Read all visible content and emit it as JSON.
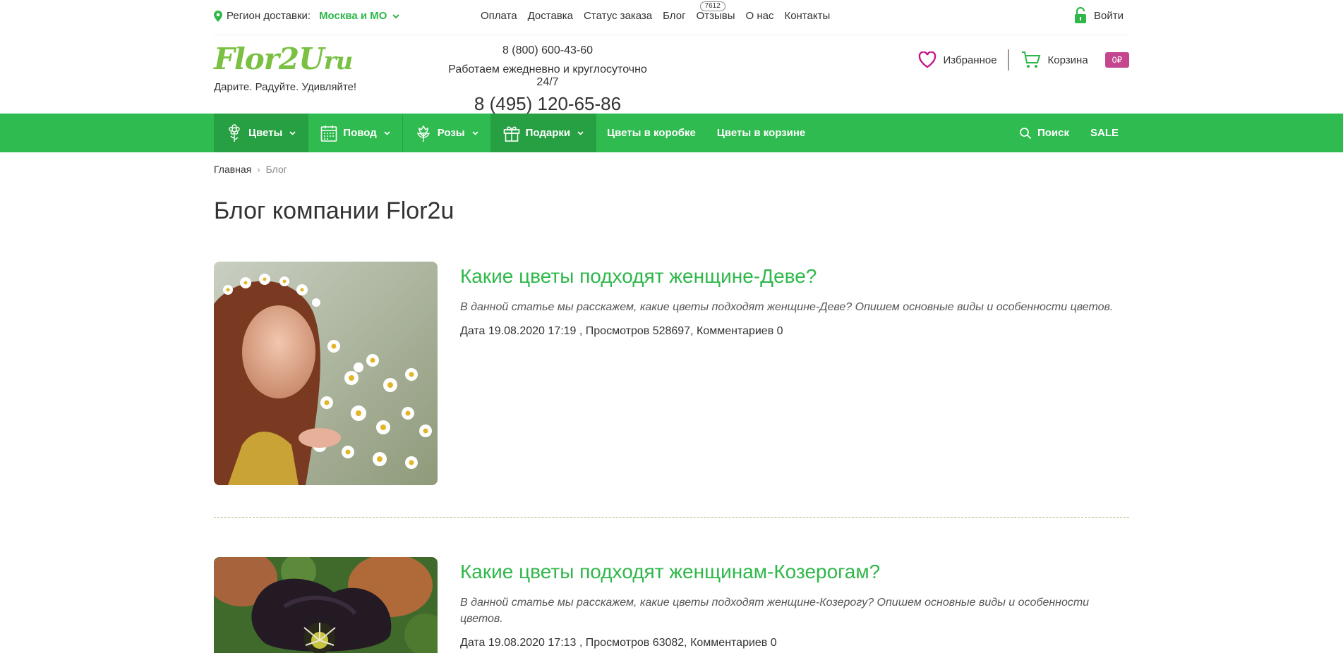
{
  "topbar": {
    "region_label": "Регион доставки:",
    "region_value": "Москва и МО",
    "nav": [
      {
        "label": "Оплата"
      },
      {
        "label": "Доставка"
      },
      {
        "label": "Статус заказа"
      },
      {
        "label": "Блог"
      },
      {
        "label": "Отзывы",
        "badge": "7612"
      },
      {
        "label": "О нас"
      },
      {
        "label": "Контакты"
      }
    ],
    "login_label": "Войти"
  },
  "header": {
    "logo_main": "Flor2U",
    "logo_ru": "ru",
    "slogan": "Дарите. Радуйте. Удивляйте!",
    "phone_free": "8 (800) 600-43-60",
    "hours": "Работаем ежедневно и круглосуточно 24/7",
    "phone_main": "8 (495) 120-65-86",
    "favorites_label": "Избранное",
    "cart_label": "Корзина",
    "cart_total": "0₽"
  },
  "mainnav": {
    "items": [
      {
        "label": "Цветы",
        "icon": "flower-icon"
      },
      {
        "label": "Повод",
        "icon": "calendar-icon"
      },
      {
        "label": "Розы",
        "icon": "rose-icon"
      },
      {
        "label": "Подарки",
        "icon": "gift-icon"
      },
      {
        "label": "Цветы в коробке"
      },
      {
        "label": "Цветы в корзине"
      }
    ],
    "search_label": "Поиск",
    "sale_label": "SALE"
  },
  "breadcrumb": {
    "home": "Главная",
    "current": "Блог"
  },
  "page_title": "Блог компании Flor2u",
  "posts": [
    {
      "title": "Какие цветы подходят женщине-Деве?",
      "excerpt": "В данной статье мы расскажем, какие цветы подходят женщине-Деве? Опишем основные виды и особенности цветов.",
      "meta": "Дата 19.08.2020 17:19 , Просмотров 528697, Комментариев 0"
    },
    {
      "title": "Какие цветы подходят женщинам-Козерогам?",
      "excerpt": "В данной статье мы расскажем, какие цветы подходят женщине-Козерогу? Опишем основные виды и особенности цветов.",
      "meta": "Дата 19.08.2020 17:13 , Просмотров 63082, Комментариев 0"
    }
  ],
  "colors": {
    "brand_green": "#2fbb4f",
    "logo_green": "#7ac143",
    "cart_badge": "#c4468f"
  }
}
